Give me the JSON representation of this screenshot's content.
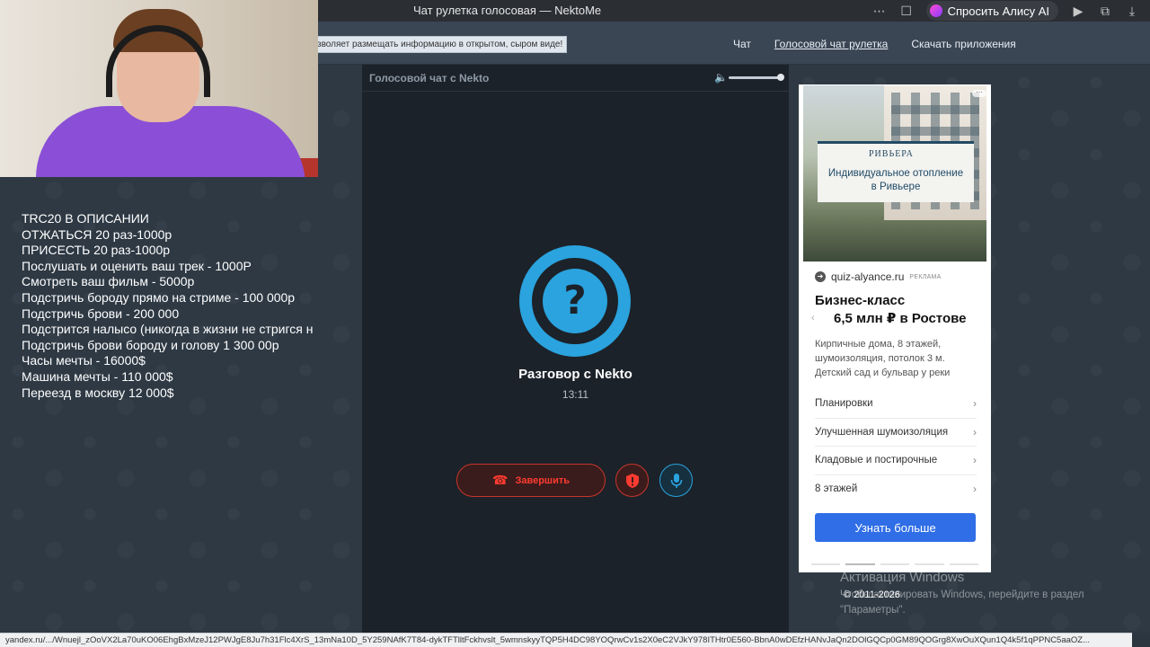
{
  "browser": {
    "title": "Чат рулетка голосовая — NektoMe",
    "alice_label": "Спросить Алису AI",
    "icons": [
      "more-icon",
      "bookmark-icon",
      "alice-icon",
      "play-icon",
      "extensions-icon",
      "download-icon"
    ]
  },
  "site": {
    "notice": "зволяет размещать информацию в открытом, сыром виде!",
    "nav": [
      "Чат",
      "Голосовой чат рулетка",
      "Скачать приложения"
    ]
  },
  "overlay": {
    "lines": [
      "TRC20 В ОПИСАНИИ",
      "ОТЖАТЬСЯ 20 раз-1000р",
      "ПРИСЕСТЬ 20 раз-1000р",
      "Послушать и оценить ваш трек - 1000Р",
      "Смотреть ваш фильм - 5000р",
      "Подстричь бороду прямо на стриме - 100 000р",
      "Подстричь брови - 200 000",
      "Подстрится налысо (никогда в жизни не стригся н",
      "Подстричь брови бороду и голову 1 300 00р",
      "Часы мечты - 16000$",
      "Машина мечты - 110 000$",
      "Переезд в москву 12 000$"
    ]
  },
  "chat": {
    "header_title": "Голосовой чат с Nekto",
    "volume_level": 1.0,
    "avatar_glyph": "?",
    "call_title": "Разговор с Nekto",
    "timer": "13:11",
    "end_label": "Завершить",
    "colors": {
      "accent": "#2aa3de",
      "danger": "#ff3b30"
    }
  },
  "ad": {
    "image_brand": "РИВЬЕРА",
    "image_headline_1": "Индивидуальное отопление",
    "image_headline_2": "в Ривьере",
    "domain": "quiz-alyance.ru",
    "tag": "РЕКЛАМА",
    "title_1": "Бизнес-класс",
    "title_2": "6,5 млн ₽ в Ростове",
    "desc": "Кирпичные дома, 8 этажей, шумоизоляция, потолок 3 м. Детский сад и бульвар у реки",
    "links": [
      "Планировки",
      "Улучшенная шумоизоляция",
      "Кладовые и постирочные",
      "8 этажей"
    ],
    "cta": "Узнать больше"
  },
  "footer": {
    "copyright": "© 2011-2026",
    "activation_title": "Активация Windows",
    "activation_sub": "Чтобы активировать Windows, перейдите в раздел \"Параметры\".",
    "status_url": "yandex.ru/.../Wnuejl_zOoVX2La70uKO06EhgBxMzeJ12PWJgE8Ju7h31Flc4XrS_13mNa10D_5Y259NAfK7T84-dykTFTlltFckhvslt_5wmnskyyTQP5H4DC98YOQrwCv1s2X0eC2VJkY978ITHtr0E560-BbnA0wDEfzHANvJaQn2DOlGQCp0GM89QOGrg8XwOuXQun1Q4k5f1qPPNC5aaOZ..."
  }
}
